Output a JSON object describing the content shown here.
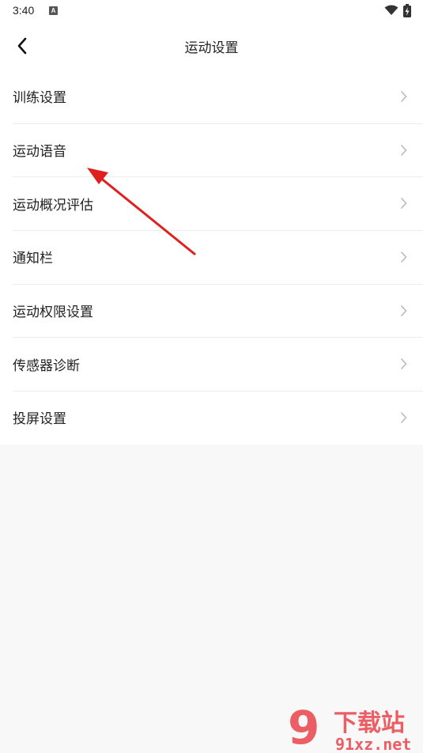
{
  "status_bar": {
    "time": "3:40",
    "notification_icon_letter": "A",
    "icons": [
      "wifi-icon",
      "battery-icon"
    ]
  },
  "header": {
    "title": "运动设置",
    "back_icon": "chevron-left-icon"
  },
  "settings": {
    "items": [
      {
        "label": "训练设置"
      },
      {
        "label": "运动语音"
      },
      {
        "label": "运动概况评估"
      },
      {
        "label": "通知栏"
      },
      {
        "label": "运动权限设置"
      },
      {
        "label": "传感器诊断"
      },
      {
        "label": "投屏设置"
      }
    ],
    "item_icon": "chevron-right-icon"
  },
  "annotation": {
    "type": "arrow",
    "color": "#e02020"
  },
  "watermark": {
    "logo_text": "9 下载站",
    "domain": "91xz.net",
    "color": "#e8434a"
  }
}
